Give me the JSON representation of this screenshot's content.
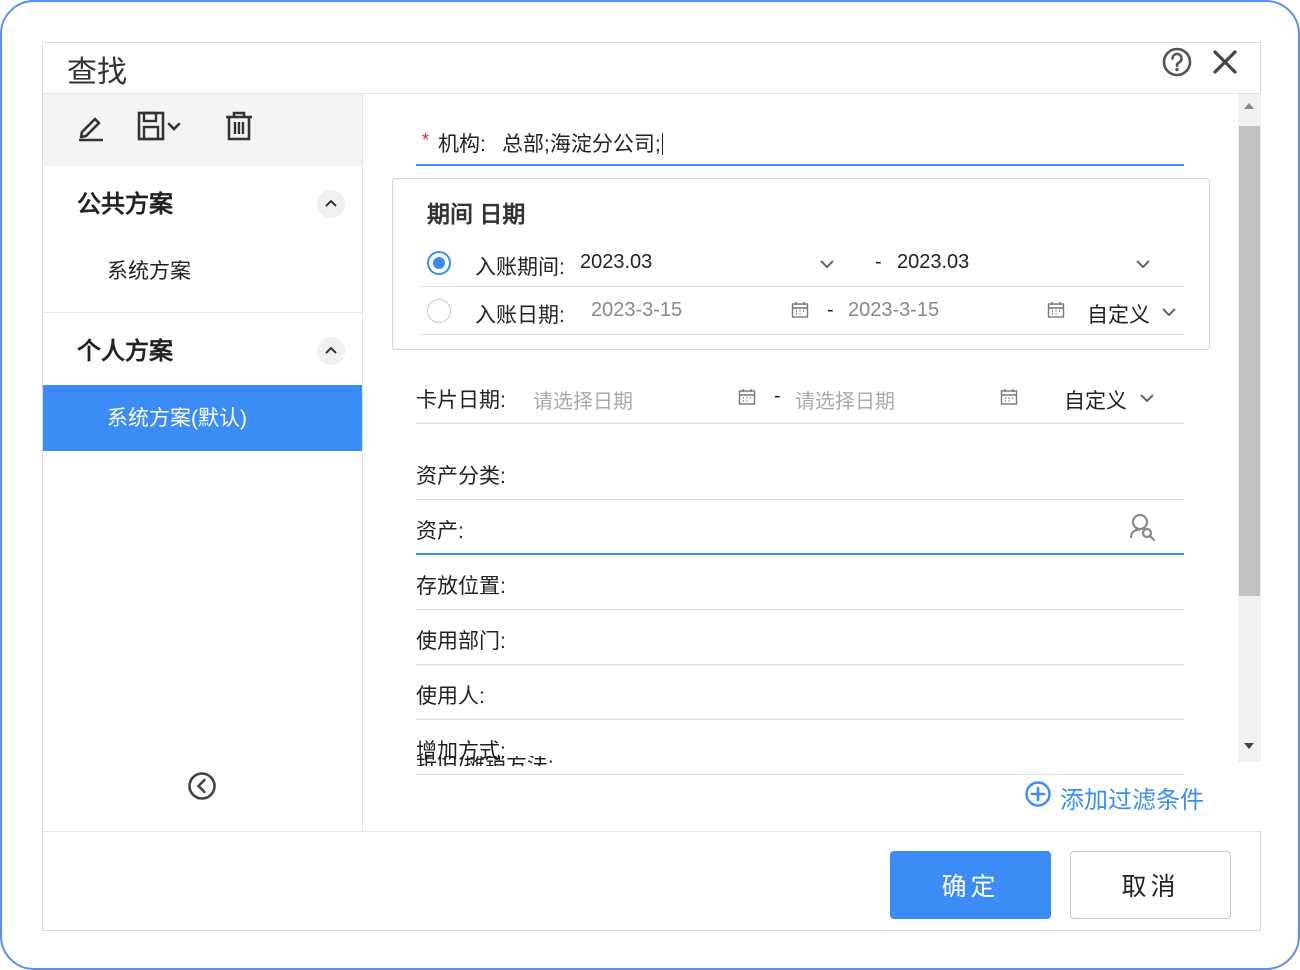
{
  "dialog": {
    "title": "查找"
  },
  "sidebar": {
    "groups": [
      {
        "title": "公共方案",
        "items": [
          {
            "label": "系统方案",
            "active": false
          }
        ]
      },
      {
        "title": "个人方案",
        "items": [
          {
            "label": "系统方案(默认)",
            "active": true
          }
        ]
      }
    ]
  },
  "form": {
    "org": {
      "required_mark": "*",
      "label": "机构:",
      "value": "总部;海淀分公司;"
    },
    "period_box": {
      "title": "期间 日期",
      "posting_period": {
        "label": "入账期间:",
        "from": "2023.03",
        "dash": "-",
        "to": "2023.03",
        "selected": true
      },
      "posting_date": {
        "label": "入账日期:",
        "from": "2023-3-15",
        "dash": "-",
        "to": "2023-3-15",
        "custom": "自定义",
        "selected": false
      }
    },
    "card_date": {
      "label": "卡片日期:",
      "from_placeholder": "请选择日期",
      "dash": "-",
      "to_placeholder": "请选择日期",
      "custom": "自定义"
    },
    "fields": [
      {
        "label": "资产分类:"
      },
      {
        "label": "资产:"
      },
      {
        "label": "存放位置:"
      },
      {
        "label": "使用部门:"
      },
      {
        "label": "使用人:"
      },
      {
        "label": "增加方式:"
      }
    ],
    "cut_label": "折旧/摊销方法:",
    "add_filter": "添加过滤条件"
  },
  "footer": {
    "ok": "确定",
    "cancel": "取消"
  },
  "colors": {
    "accent": "#3c8cf5",
    "required": "#e02020",
    "frame": "#5b8fe8"
  }
}
